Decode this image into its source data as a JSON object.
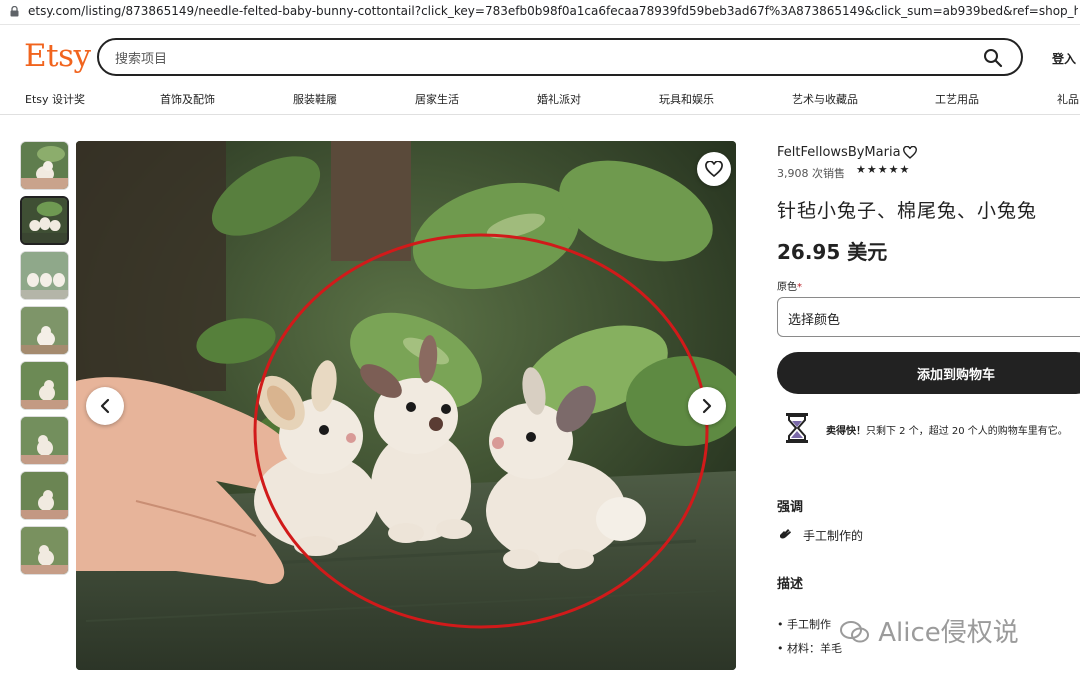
{
  "browser": {
    "url": "etsy.com/listing/873865149/needle-felted-baby-bunny-cottontail?click_key=783efb0b98f0a1ca6fecaa78939fd59beb3ad67f%3A873865149&click_sum=ab939bed&ref=shop_home_active_..."
  },
  "header": {
    "logo": "Etsy",
    "search_placeholder": "搜索项目",
    "login": "登入"
  },
  "nav": {
    "items": [
      "Etsy 设计奖",
      "首饰及配饰",
      "服装鞋履",
      "居家生活",
      "婚礼派对",
      "玩具和娱乐",
      "艺术与收藏品",
      "工艺用品",
      "礼品"
    ]
  },
  "listing": {
    "shop_name": "FeltFellowsByMaria",
    "sales": "3,908 次销售",
    "stars": "★★★★★",
    "title": "针毡小兔子、棉尾兔、小兔兔",
    "price": "26.95 美元",
    "color_label": "原色",
    "required_mark": "*",
    "color_select": "选择颜色",
    "add_to_cart": "添加到购物车",
    "stock_strong": "卖得快！",
    "stock_rest": "只剩下 2 个，超过 20 个人的购物车里有它。",
    "highlights_heading": "强调",
    "highlight_item": "手工制作的",
    "description_heading": "描述",
    "description_lines": [
      "• 手工制作",
      "• 材料：羊毛"
    ]
  },
  "watermark": "Alice侵权说",
  "colors": {
    "accent": "#f1641e",
    "button": "#222222",
    "annotation": "#d11a1a"
  }
}
